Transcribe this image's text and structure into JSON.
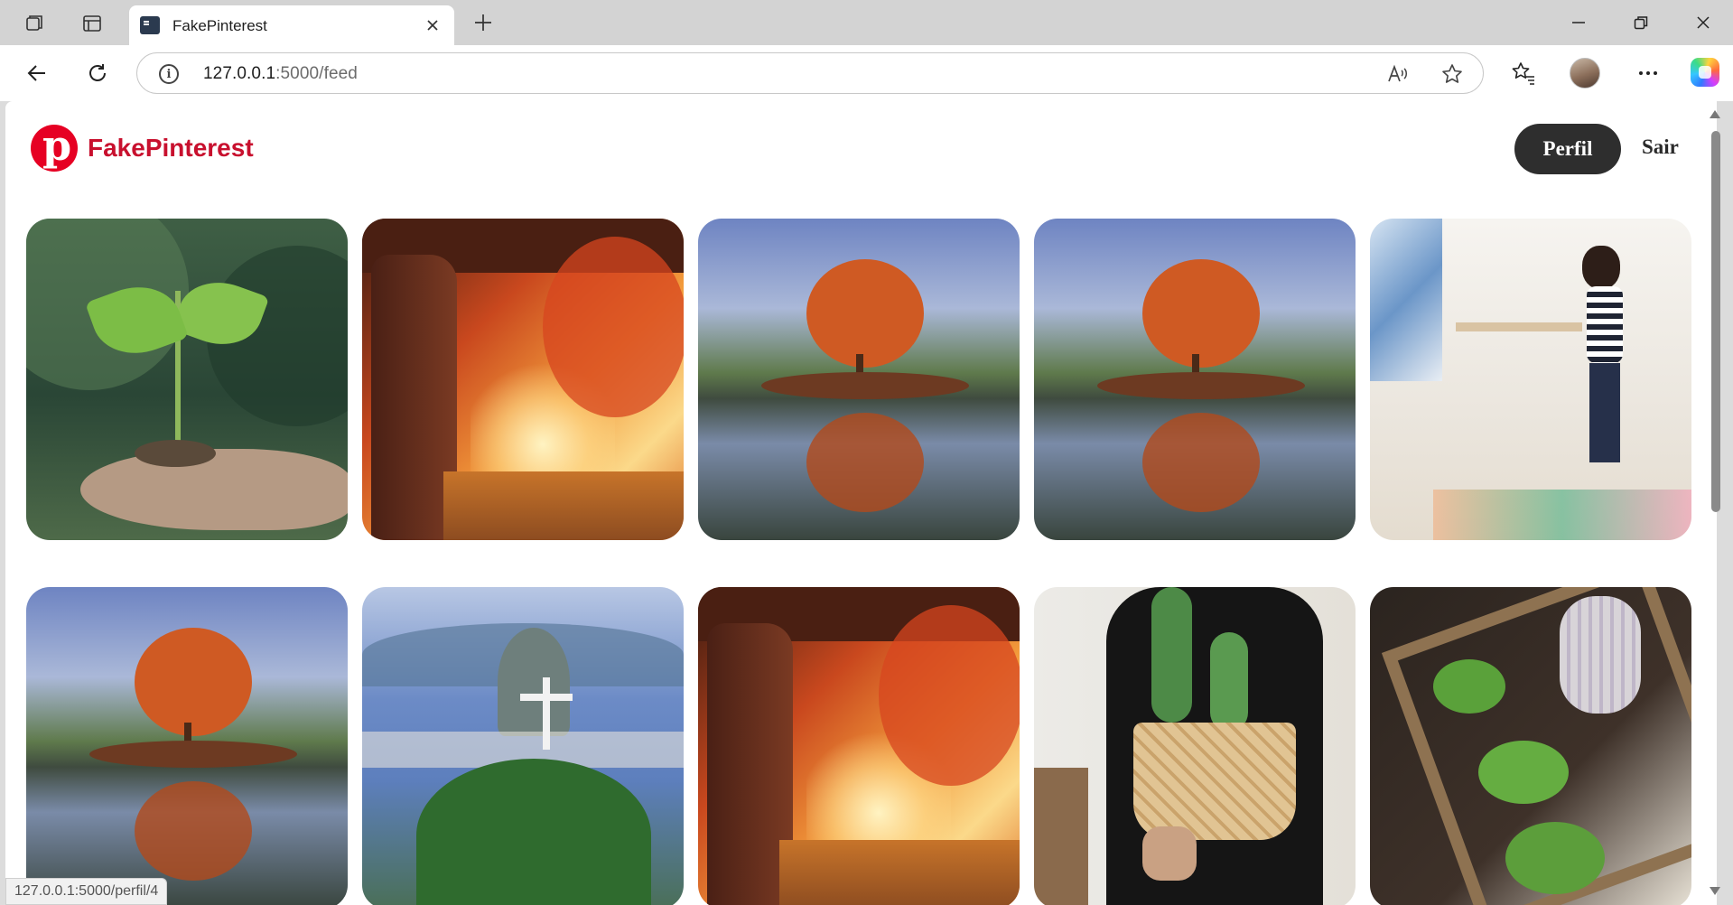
{
  "browser": {
    "tab_title": "FakePinterest",
    "url_host": "127.0.0.1",
    "url_path": ":5000/feed",
    "status_text": "127.0.0.1:5000/perfil/4"
  },
  "site": {
    "brand": "FakePinterest",
    "nav": {
      "perfil_label": "Perfil",
      "sair_label": "Sair"
    }
  },
  "feed": {
    "items": [
      {
        "subject": "sprout-in-hand",
        "colors": [
          "#2d4c37",
          "#6f8f5a",
          "#b69a86"
        ]
      },
      {
        "subject": "autumn-forest-path",
        "colors": [
          "#6a2f1c",
          "#e9622a",
          "#f7c868"
        ]
      },
      {
        "subject": "autumn-tree-lake",
        "colors": [
          "#4d6fa8",
          "#c7592a",
          "#3b4a3f"
        ]
      },
      {
        "subject": "autumn-tree-lake",
        "colors": [
          "#4d6fa8",
          "#c7592a",
          "#3b4a3f"
        ]
      },
      {
        "subject": "child-playing-room",
        "colors": [
          "#f2f0ec",
          "#2a2f48",
          "#e5d7c4"
        ]
      },
      {
        "subject": "autumn-tree-lake",
        "colors": [
          "#4d6fa8",
          "#c7592a",
          "#3b4a3f"
        ]
      },
      {
        "subject": "christ-redeemer-rio",
        "colors": [
          "#6f8cc7",
          "#2f6a2f",
          "#d8dde6"
        ]
      },
      {
        "subject": "autumn-forest-path",
        "colors": [
          "#6a2f1c",
          "#e9622a",
          "#f7c868"
        ]
      },
      {
        "subject": "cactus-basket",
        "colors": [
          "#e8e4de",
          "#1b1b1b",
          "#d9b98a"
        ]
      },
      {
        "subject": "seedlings-wooden-box",
        "colors": [
          "#3a2e26",
          "#5fa03b",
          "#c9b89c"
        ]
      }
    ]
  }
}
